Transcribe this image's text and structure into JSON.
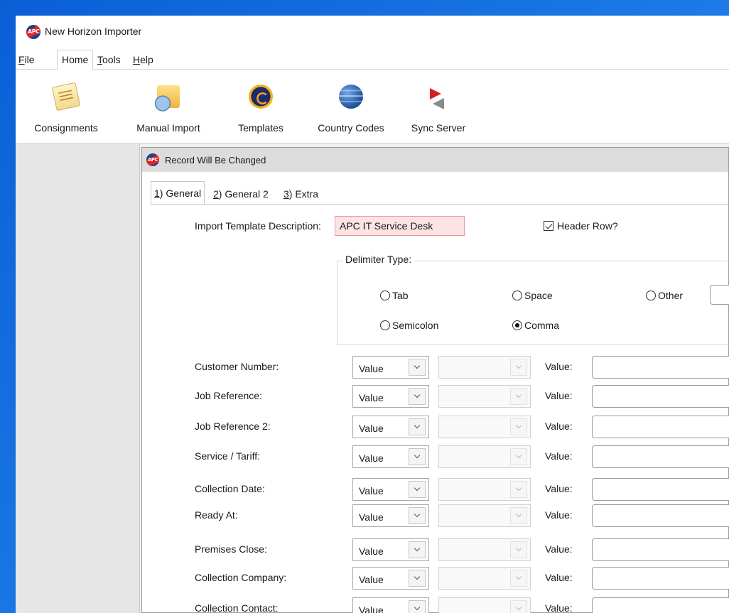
{
  "app": {
    "title": "New Horizon Importer"
  },
  "menu": [
    {
      "label_ul": "F",
      "label_rest": "ile"
    },
    {
      "label_ul": "",
      "label_rest": "Home"
    },
    {
      "label_ul": "T",
      "label_rest": "ools"
    },
    {
      "label_ul": "H",
      "label_rest": "elp"
    }
  ],
  "ribbon": [
    {
      "label": "Consignments",
      "icon": "consignments-icon"
    },
    {
      "label": "Manual Import",
      "icon": "manual-import-icon"
    },
    {
      "label": "Templates",
      "icon": "templates-icon"
    },
    {
      "label": "Country Codes",
      "icon": "country-codes-icon"
    },
    {
      "label": "Sync Server",
      "icon": "sync-server-icon"
    }
  ],
  "dialog": {
    "title": "Record Will Be Changed",
    "tabs": [
      {
        "num": "1",
        "rest": ") General"
      },
      {
        "num": "2",
        "rest": ") General 2"
      },
      {
        "num": "3",
        "rest": ") Extra"
      }
    ],
    "description_label": "Import Template Description:",
    "description_value": "APC IT Service Desk",
    "header_row_label": "Header Row?",
    "header_row_checked": true,
    "delimiter": {
      "title": "Delimiter Type:",
      "options": [
        "Tab",
        "Space",
        "Other",
        "Semicolon",
        "Comma"
      ],
      "selected": "Comma"
    },
    "value_label": "Value:",
    "fields": [
      {
        "name": "Customer Number:",
        "type": "Value"
      },
      {
        "name": "Job Reference:",
        "type": "Value"
      },
      {
        "name": "Job Reference 2:",
        "type": "Value"
      },
      {
        "name": "Service / Tariff:",
        "type": "Value"
      },
      {
        "name": "Collection Date:",
        "type": "Value"
      },
      {
        "name": "Ready At:",
        "type": "Value"
      },
      {
        "name": "Premises Close:",
        "type": "Value"
      },
      {
        "name": "Collection Company:",
        "type": "Value"
      },
      {
        "name": "Collection Contact:",
        "type": "Value"
      }
    ]
  }
}
